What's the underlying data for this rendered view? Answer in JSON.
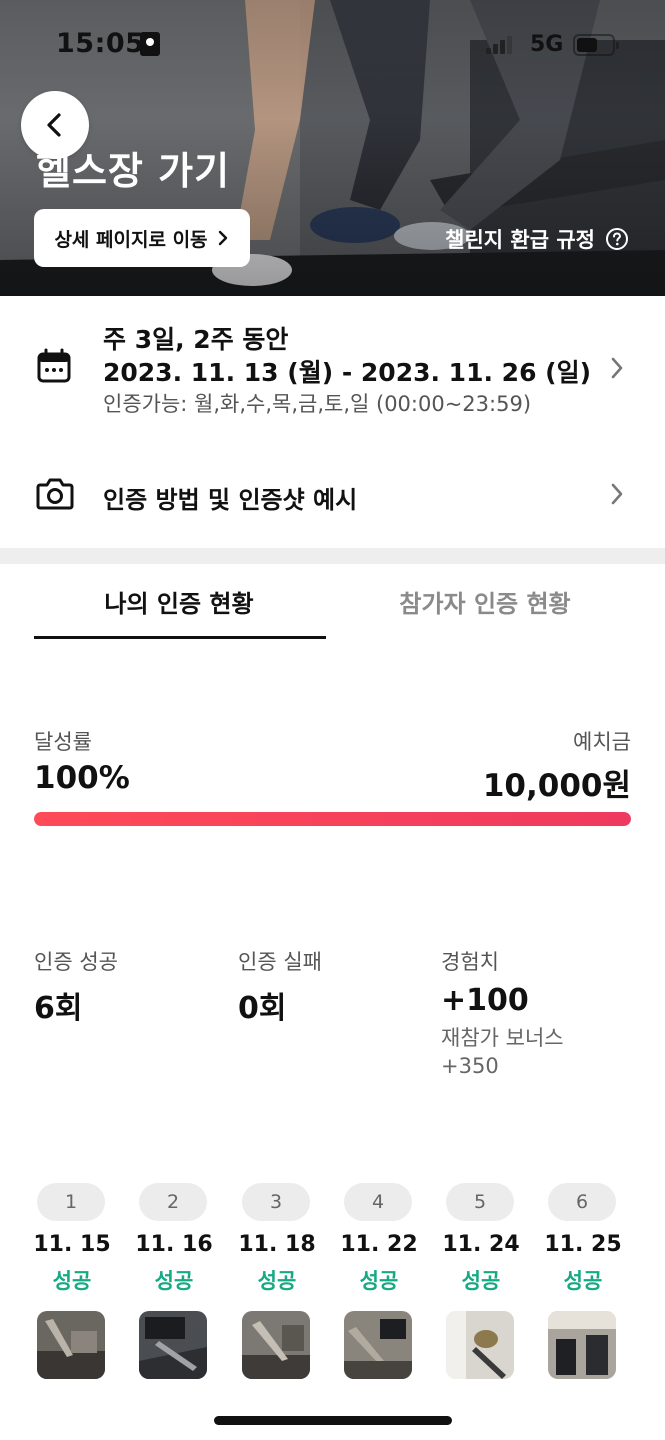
{
  "status_bar": {
    "time": "15:05",
    "network": "5G"
  },
  "hero": {
    "title": "헬스장 가기",
    "detail_button_label": "상세 페이지로 이동",
    "refund_link_label": "챌린지 환급 규정"
  },
  "schedule": {
    "frequency": "주 3일, 2주 동안",
    "date_range": "2023. 11. 13 (월) - 2023. 11. 26 (일)",
    "available": "인증가능: 월,화,수,목,금,토,일 (00:00~23:59)"
  },
  "method": {
    "label": "인증 방법 및 인증샷 예시"
  },
  "tabs": [
    {
      "label": "나의 인증 현황",
      "active": true
    },
    {
      "label": "참가자 인증 현황",
      "active": false
    }
  ],
  "progress": {
    "rate_label": "달성률",
    "rate_value": "100%",
    "rate_fraction": 1.0,
    "deposit_label": "예치금",
    "deposit_value": "10,000원",
    "bar_color": "#f2405a"
  },
  "stats": {
    "success_label": "인증 성공",
    "success_value": "6회",
    "fail_label": "인증 실패",
    "fail_value": "0회",
    "exp_label": "경험치",
    "exp_value": "+100",
    "bonus_label": "재참가 보너스",
    "bonus_value": "+350"
  },
  "days": [
    {
      "index": "1",
      "date": "11. 15",
      "status": "성공"
    },
    {
      "index": "2",
      "date": "11. 16",
      "status": "성공"
    },
    {
      "index": "3",
      "date": "11. 18",
      "status": "성공"
    },
    {
      "index": "4",
      "date": "11. 22",
      "status": "성공"
    },
    {
      "index": "5",
      "date": "11. 24",
      "status": "성공"
    },
    {
      "index": "6",
      "date": "11. 25",
      "status": "성공"
    }
  ],
  "colors": {
    "success": "#17a983",
    "accent": "#f2405a"
  },
  "icons": [
    "back-arrow-icon",
    "chevron-right-icon",
    "question-circle-icon",
    "calendar-icon",
    "camera-icon"
  ]
}
